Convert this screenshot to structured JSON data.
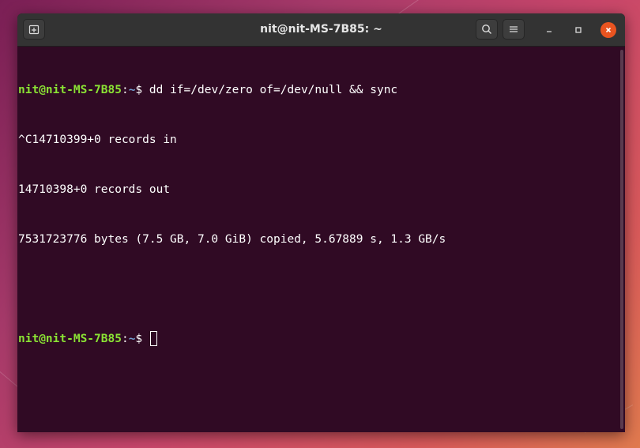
{
  "window": {
    "title": "nit@nit-MS-7B85: ~"
  },
  "titlebar": {
    "new_tab_icon": "new-tab-icon",
    "search_icon": "search-icon",
    "menu_icon": "hamburger-menu-icon",
    "minimize_glyph": "–",
    "maximize_glyph": "▫",
    "close_glyph": "✕"
  },
  "terminal": {
    "prompt_user": "nit@nit-MS-7B85",
    "prompt_sep": ":",
    "prompt_path": "~",
    "prompt_symbol": "$ ",
    "command": "dd if=/dev/zero of=/dev/null && sync",
    "output": [
      "^C14710399+0 records in",
      "14710398+0 records out",
      "7531723776 bytes (7.5 GB, 7.0 GiB) copied, 5.67889 s, 1.3 GB/s"
    ]
  },
  "colors": {
    "terminal_bg": "#300a24",
    "prompt_user": "#8ae234",
    "prompt_path": "#729fcf",
    "close_button": "#e95420"
  }
}
